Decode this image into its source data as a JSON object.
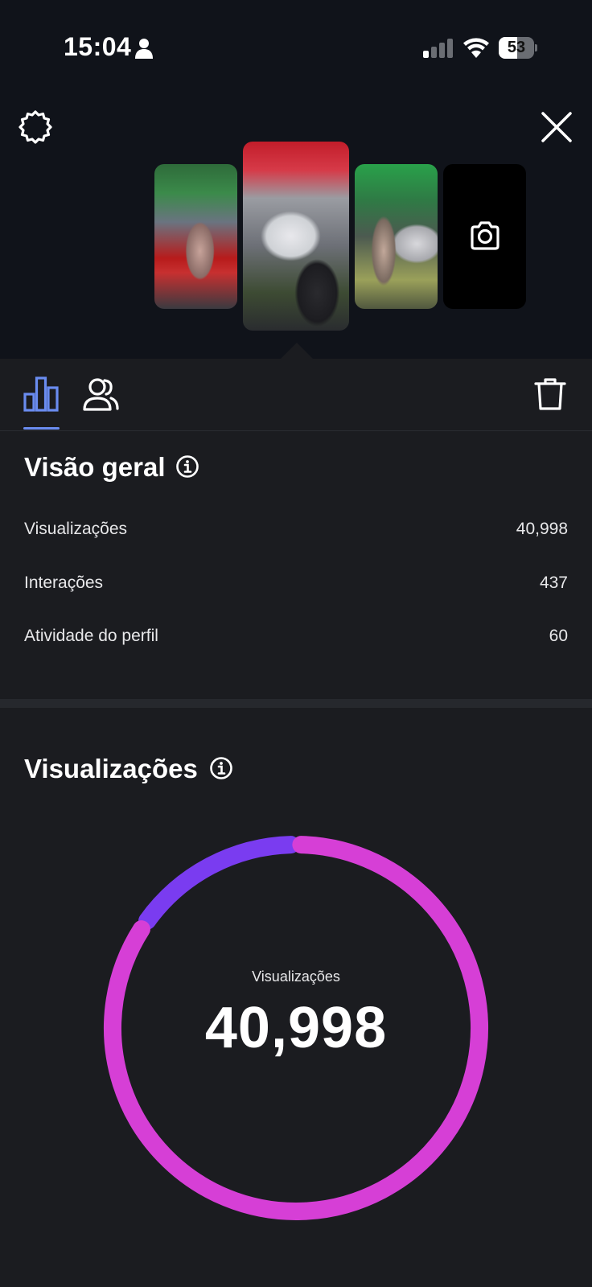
{
  "status_bar": {
    "time": "15:04",
    "battery": "53",
    "battery_level": 0.53
  },
  "overview": {
    "title": "Visão geral",
    "metrics": [
      {
        "label": "Visualizações",
        "value": "40,998"
      },
      {
        "label": "Interações",
        "value": "437"
      },
      {
        "label": "Atividade do perfil",
        "value": "60"
      }
    ]
  },
  "views": {
    "title": "Visualizações",
    "donut_label": "Visualizações",
    "donut_value": "40,998"
  },
  "chart_data": {
    "type": "pie",
    "segments": [
      {
        "fraction": 0.155,
        "color": "#7a3cf0"
      },
      {
        "fraction": 0.845,
        "color": "#d63fd6"
      }
    ]
  },
  "colors": {
    "accent": "#6a8cf0",
    "followers_segment": "#7a3cf0",
    "non_followers_segment": "#d63fd6"
  }
}
